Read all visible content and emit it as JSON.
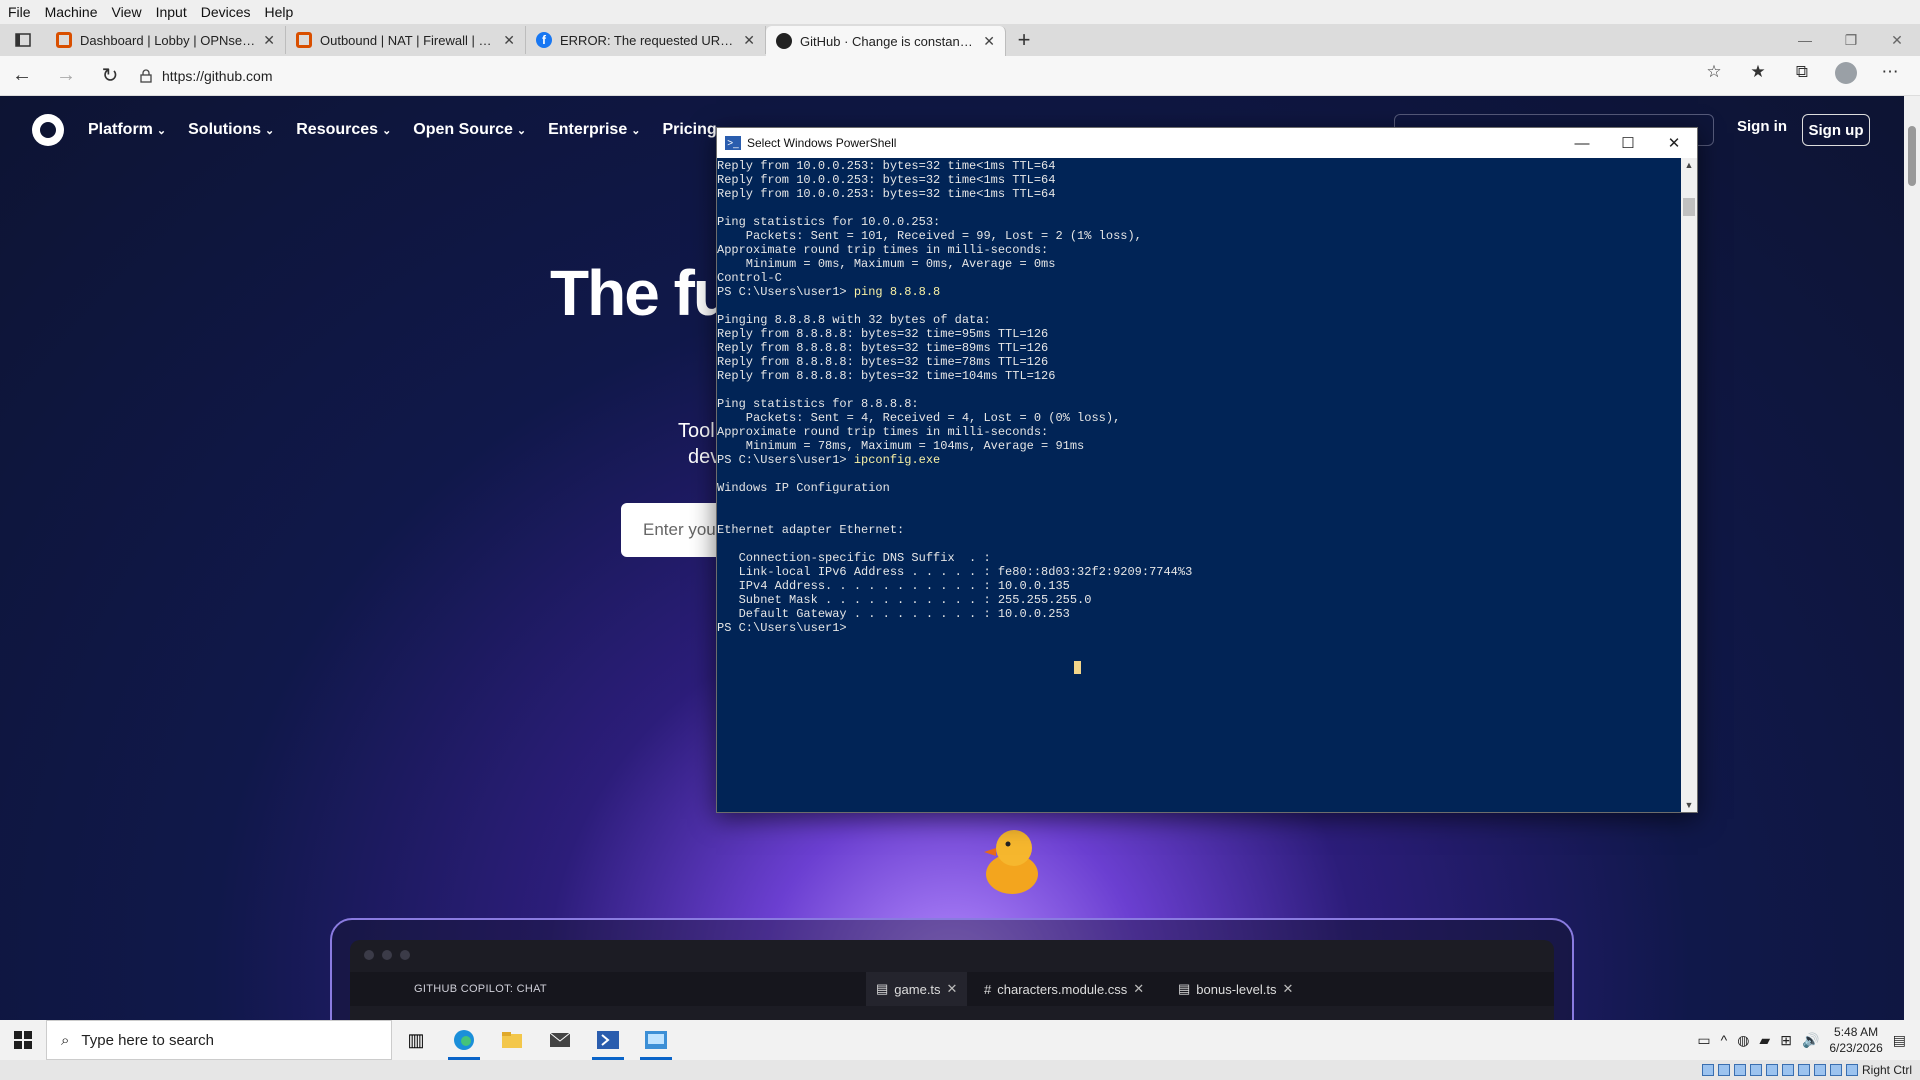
{
  "vbox_menu": [
    "File",
    "Machine",
    "View",
    "Input",
    "Devices",
    "Help"
  ],
  "tabs": [
    {
      "title": "Dashboard | Lobby | OPNsense.i",
      "icon": "opnsense-icon"
    },
    {
      "title": "Outbound | NAT | Firewall | OPN",
      "icon": "opnsense-icon"
    },
    {
      "title": "ERROR: The requested URL coul",
      "icon": "facebook-icon"
    },
    {
      "title": "GitHub · Change is constant. Git",
      "icon": "github-icon",
      "active": true
    }
  ],
  "address": {
    "url": "https://github.com"
  },
  "github": {
    "nav": [
      "Platform",
      "Solutions",
      "Resources",
      "Open Source",
      "Enterprise",
      "Pricing"
    ],
    "sign_in": "Sign in",
    "sign_up": "Sign up",
    "hero": "The fu",
    "sub1": "Tool",
    "sub2": "dev",
    "email_placeholder": "Enter you",
    "ide": {
      "chat_label": "GITHUB COPILOT: CHAT",
      "tabs": [
        "game.ts",
        "characters.module.css",
        "bonus-level.ts"
      ]
    }
  },
  "powershell": {
    "title": "Select Windows PowerShell",
    "lines": [
      {
        "t": "Reply from 10.0.0.253: bytes=32 time<1ms TTL=64"
      },
      {
        "t": "Reply from 10.0.0.253: bytes=32 time<1ms TTL=64"
      },
      {
        "t": "Reply from 10.0.0.253: bytes=32 time<1ms TTL=64"
      },
      {
        "t": ""
      },
      {
        "t": "Ping statistics for 10.0.0.253:"
      },
      {
        "t": "    Packets: Sent = 101, Received = 99, Lost = 2 (1% loss),"
      },
      {
        "t": "Approximate round trip times in milli-seconds:"
      },
      {
        "t": "    Minimum = 0ms, Maximum = 0ms, Average = 0ms"
      },
      {
        "t": "Control-C"
      },
      {
        "t": "PS C:\\Users\\user1> ",
        "cmd": "ping 8.8.8.8"
      },
      {
        "t": ""
      },
      {
        "t": "Pinging 8.8.8.8 with 32 bytes of data:"
      },
      {
        "t": "Reply from 8.8.8.8: bytes=32 time=95ms TTL=126"
      },
      {
        "t": "Reply from 8.8.8.8: bytes=32 time=89ms TTL=126"
      },
      {
        "t": "Reply from 8.8.8.8: bytes=32 time=78ms TTL=126"
      },
      {
        "t": "Reply from 8.8.8.8: bytes=32 time=104ms TTL=126"
      },
      {
        "t": ""
      },
      {
        "t": "Ping statistics for 8.8.8.8:"
      },
      {
        "t": "    Packets: Sent = 4, Received = 4, Lost = 0 (0% loss),"
      },
      {
        "t": "Approximate round trip times in milli-seconds:"
      },
      {
        "t": "    Minimum = 78ms, Maximum = 104ms, Average = 91ms"
      },
      {
        "t": "PS C:\\Users\\user1> ",
        "cmd": "ipconfig.exe"
      },
      {
        "t": ""
      },
      {
        "t": "Windows IP Configuration"
      },
      {
        "t": ""
      },
      {
        "t": ""
      },
      {
        "t": "Ethernet adapter Ethernet:"
      },
      {
        "t": ""
      },
      {
        "t": "   Connection-specific DNS Suffix  . :"
      },
      {
        "t": "   Link-local IPv6 Address . . . . . : fe80::8d03:32f2:9209:7744%3"
      },
      {
        "t": "   IPv4 Address. . . . . . . . . . . : 10.0.0.135"
      },
      {
        "t": "   Subnet Mask . . . . . . . . . . . : 255.255.255.0"
      },
      {
        "t": "   Default Gateway . . . . . . . . . : 10.0.0.253"
      },
      {
        "t": "PS C:\\Users\\user1>"
      }
    ]
  },
  "taskbar": {
    "search_placeholder": "Type here to search",
    "time": "5:48 AM",
    "date": "6/23/2026"
  },
  "vbox_status": {
    "host_key": "Right Ctrl"
  },
  "colors": {
    "ps_bg": "#012456",
    "ps_cmd": "#f9f1a5",
    "gh_bg": "#0d1433"
  }
}
